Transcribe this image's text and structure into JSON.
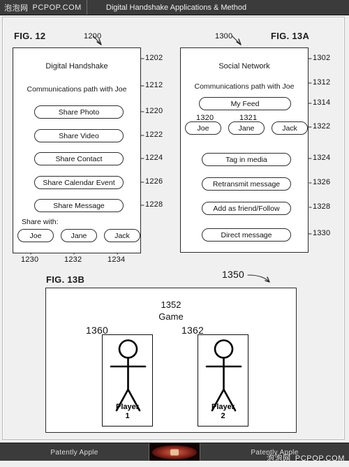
{
  "titlebar": {
    "brand_cn": "泡泡网",
    "brand_en": "PCPOP.COM",
    "doc_title": "Digital Handshake Applications & Method"
  },
  "figures": {
    "fig12": {
      "label": "FIG. 12",
      "device_ref": "1200",
      "heading": "Digital Handshake",
      "heading_ref": "1202",
      "subheading": "Communications path with Joe",
      "subheading_ref": "1212",
      "buttons": [
        {
          "label": "Share Photo",
          "ref": "1220"
        },
        {
          "label": "Share Video",
          "ref": "1222"
        },
        {
          "label": "Share Contact",
          "ref": "1224"
        },
        {
          "label": "Share Calendar Event",
          "ref": "1226"
        },
        {
          "label": "Share Message",
          "ref": "1228"
        }
      ],
      "share_with_label": "Share with:",
      "contacts": [
        {
          "label": "Joe",
          "ref": "1230"
        },
        {
          "label": "Jane",
          "ref": "1232"
        },
        {
          "label": "Jack",
          "ref": "1234"
        }
      ]
    },
    "fig13a": {
      "label": "FIG. 13A",
      "device_ref": "1300",
      "heading": "Social Network",
      "heading_ref": "1302",
      "subheading": "Communications path with Joe",
      "subheading_ref": "1312",
      "feed_button": {
        "label": "My Feed",
        "ref": "1314"
      },
      "contacts_ref": "1322",
      "contacts": [
        {
          "label": "Joe",
          "ref": "1320"
        },
        {
          "label": "Jane",
          "ref": "1321"
        },
        {
          "label": "Jack",
          "ref": ""
        }
      ],
      "buttons": [
        {
          "label": "Tag in media",
          "ref": "1324"
        },
        {
          "label": "Retransmit message",
          "ref": "1326"
        },
        {
          "label": "Add as friend/Follow",
          "ref": "1328"
        },
        {
          "label": "Direct message",
          "ref": "1330"
        }
      ]
    },
    "fig13b": {
      "label": "FIG. 13B",
      "device_ref": "1350",
      "game_ref": "1352",
      "game_title": "Game",
      "players": [
        {
          "ref": "1360",
          "name": "Player",
          "number": "1"
        },
        {
          "ref": "1362",
          "name": "Player",
          "number": "2"
        }
      ]
    }
  },
  "footer": {
    "left_text": "Patently Apple",
    "right_text": "Patently Apple",
    "watermark_cn": "泡泡网",
    "watermark_en": "PCPOP.COM"
  },
  "colors": {
    "chrome": "#3b3b3b",
    "paper": "#f0f0f0",
    "ink": "#1b1b1b"
  }
}
